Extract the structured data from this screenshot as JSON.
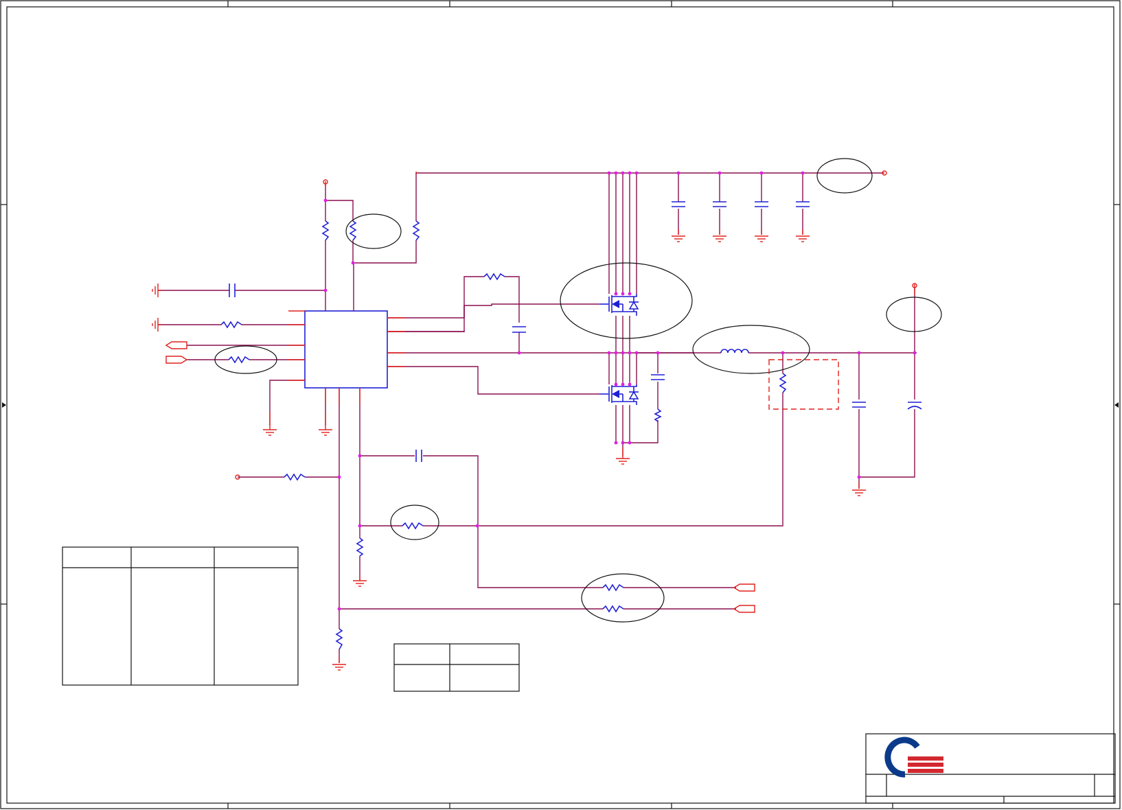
{
  "diagram": {
    "kind": "schematic",
    "colors": {
      "wire": "#8a0f4e",
      "pin": "#e0201d",
      "component": "#1f1fd6",
      "junction": "#e11fe0",
      "frame": "#111111",
      "logo_blue": "#0b3a8a",
      "logo_red": "#d3282f"
    },
    "icons": [
      "resistor-icon",
      "capacitor-icon",
      "inductor-icon",
      "mosfet-icon",
      "ground-icon",
      "port-icon",
      "power-pin-icon",
      "company-logo"
    ],
    "labels": []
  }
}
